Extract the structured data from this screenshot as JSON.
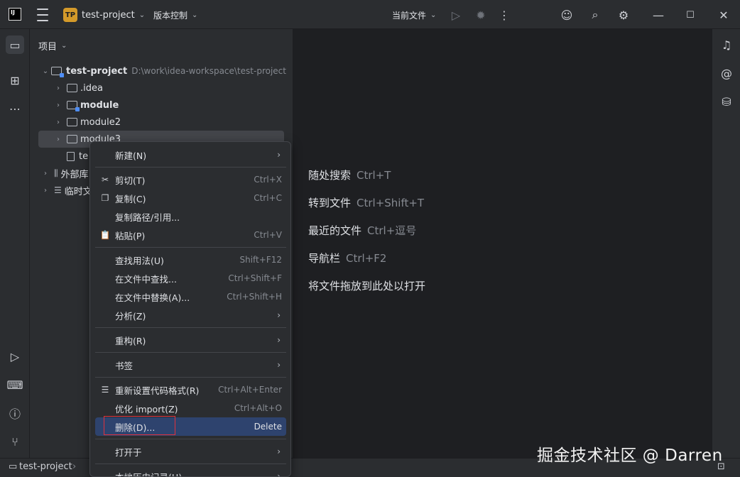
{
  "titlebar": {
    "logo": "IJ",
    "project_badge": "TP",
    "project_name": "test-project",
    "vcs_label": "版本控制",
    "run_config": "当前文件"
  },
  "panel": {
    "title": "项目",
    "tree": [
      {
        "label": "test-project",
        "hint": "D:\\work\\idea-workspace\\test-project",
        "bold": true
      },
      {
        "label": ".idea"
      },
      {
        "label": "module",
        "bold": true
      },
      {
        "label": "module2"
      },
      {
        "label": "module3"
      },
      {
        "label": "te"
      },
      {
        "label": "外部库"
      },
      {
        "label": "临时文"
      }
    ]
  },
  "editor_hints": [
    {
      "label": "随处搜索",
      "shortcut": "Ctrl+T"
    },
    {
      "label": "转到文件",
      "shortcut": "Ctrl+Shift+T"
    },
    {
      "label": "最近的文件",
      "shortcut": "Ctrl+逗号"
    },
    {
      "label": "导航栏",
      "shortcut": "Ctrl+F2"
    },
    {
      "label": "将文件拖放到此处以打开",
      "shortcut": ""
    }
  ],
  "context_menu": {
    "new": {
      "label": "新建(N)"
    },
    "cut": {
      "label": "剪切(T)",
      "shortcut": "Ctrl+X"
    },
    "copy": {
      "label": "复制(C)",
      "shortcut": "Ctrl+C"
    },
    "copy_path": {
      "label": "复制路径/引用..."
    },
    "paste": {
      "label": "粘贴(P)",
      "shortcut": "Ctrl+V"
    },
    "find_usages": {
      "label": "查找用法(U)",
      "shortcut": "Shift+F12"
    },
    "find_in_files": {
      "label": "在文件中查找...",
      "shortcut": "Ctrl+Shift+F"
    },
    "replace_in_files": {
      "label": "在文件中替换(A)...",
      "shortcut": "Ctrl+Shift+H"
    },
    "analyze": {
      "label": "分析(Z)"
    },
    "refactor": {
      "label": "重构(R)"
    },
    "bookmarks": {
      "label": "书签"
    },
    "reformat": {
      "label": "重新设置代码格式(R)",
      "shortcut": "Ctrl+Alt+Enter"
    },
    "optimize_imports": {
      "label": "优化 import(Z)",
      "shortcut": "Ctrl+Alt+O"
    },
    "delete": {
      "label": "删除(D)...",
      "shortcut": "Delete"
    },
    "open_in": {
      "label": "打开于"
    },
    "local_history": {
      "label": "本地历史记录(H)"
    }
  },
  "statusbar": {
    "project": "test-project"
  },
  "watermark": "掘金技术社区 @ Darren",
  "colors": {
    "background": "#1e1f22",
    "panel": "#2b2d30",
    "selection": "#2e436e",
    "highlight_box": "#e0313b",
    "badge": "#d49a2a"
  }
}
